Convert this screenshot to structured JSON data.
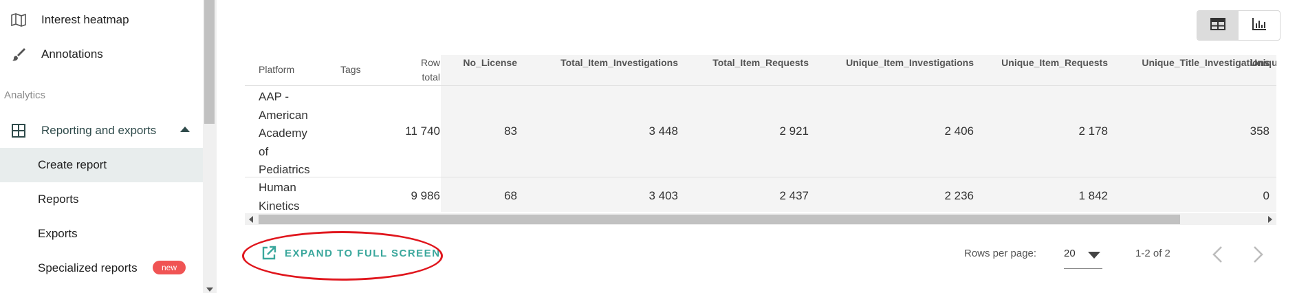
{
  "sidebar": {
    "items": [
      {
        "label": "Interest heatmap",
        "icon": "map-icon"
      },
      {
        "label": "Annotations",
        "icon": "brush-icon"
      }
    ],
    "section_header": "Analytics",
    "group": {
      "label": "Reporting and exports",
      "icon": "grid-icon",
      "expanded": true
    },
    "sub_items": [
      {
        "label": "Create report",
        "active": true
      },
      {
        "label": "Reports"
      },
      {
        "label": "Exports"
      },
      {
        "label": "Specialized reports",
        "badge": "new"
      }
    ]
  },
  "view_toggle": {
    "table_icon": "table-icon",
    "chart_icon": "bar-chart-icon",
    "selected": "table"
  },
  "table": {
    "columns": [
      "Platform",
      "Tags",
      "Row total",
      "No_License",
      "Total_Item_Investigations",
      "Total_Item_Requests",
      "Unique_Item_Investigations",
      "Unique_Item_Requests",
      "Unique_Title_Investigations",
      "Uniqu"
    ],
    "row_total_header": [
      "Row",
      "total"
    ],
    "rows": [
      {
        "platform_lines": [
          "AAP -",
          "American",
          "Academy",
          "of",
          "Pediatrics"
        ],
        "tags": "",
        "values": [
          "11 740",
          "83",
          "3 448",
          "2 921",
          "2 406",
          "2 178",
          "358"
        ]
      },
      {
        "platform_lines": [
          "Human",
          "Kinetics"
        ],
        "tags": "",
        "values": [
          "9 986",
          "68",
          "3 403",
          "2 437",
          "2 236",
          "1 842",
          "0"
        ]
      }
    ]
  },
  "footer": {
    "expand_label": "EXPAND TO FULL SCREEN",
    "rows_per_page_label": "Rows per page:",
    "rows_per_page_value": "20",
    "range_text": "1-2 of 2"
  },
  "colors": {
    "accent": "#3aa79c",
    "annotation": "#e0161d",
    "badge": "#f05454",
    "active_bg": "#e8eded"
  }
}
